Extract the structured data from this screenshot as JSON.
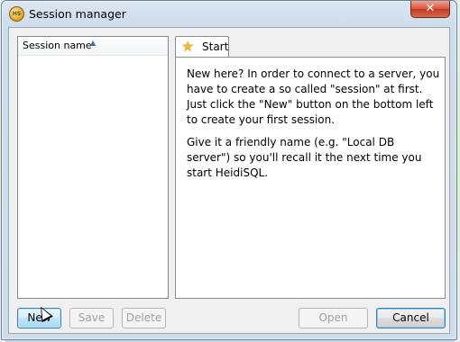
{
  "window": {
    "title": "Session manager",
    "app_icon_text": "HS",
    "close_glyph": "✕"
  },
  "session_list": {
    "column_header": "Session name",
    "sort_glyph": "▲",
    "items": []
  },
  "tabs": [
    {
      "label": "Start",
      "icon": "star-icon"
    }
  ],
  "start_panel": {
    "paragraph1": "New here? In order to connect to a server, you have to create a so called \"session\" at first. Just click the \"New\" button on the bottom left to create your first session.",
    "paragraph2": "Give it a friendly name (e.g. \"Local DB server\") so you'll recall it the next time you start HeidiSQL."
  },
  "buttons": {
    "new": "New",
    "save": "Save",
    "delete": "Delete",
    "open": "Open",
    "cancel": "Cancel"
  },
  "colors": {
    "accent": "#3c7fb1",
    "star": "#f2b630",
    "close_button": "#c23b22"
  }
}
